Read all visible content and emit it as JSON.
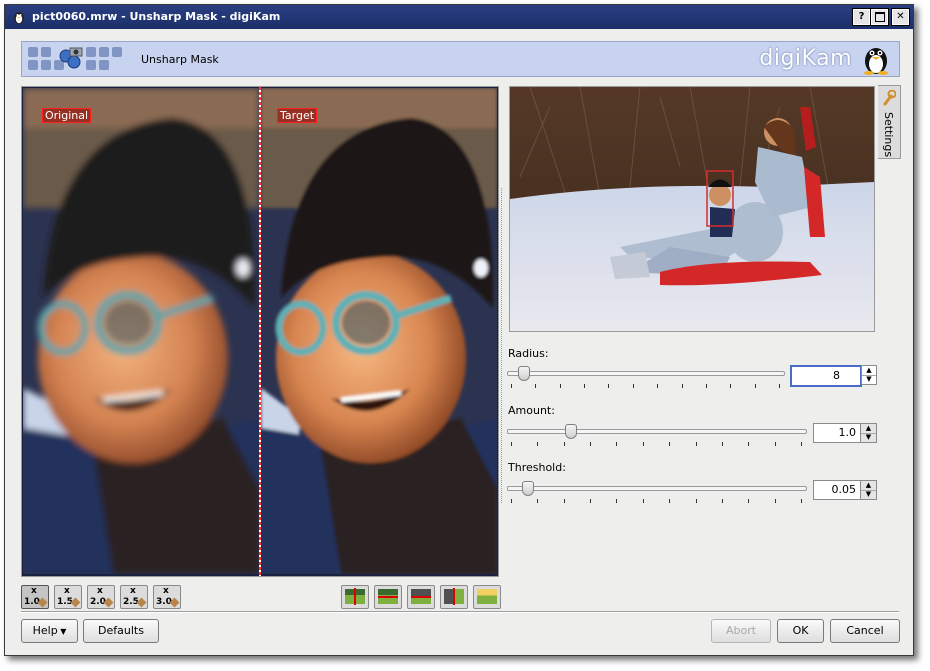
{
  "window": {
    "title": "pict0060.mrw - Unsharp Mask - digiKam"
  },
  "titlebar_buttons": {
    "help": "?",
    "close": "✕"
  },
  "header": {
    "title": "Unsharp Mask",
    "brand": "digiKam"
  },
  "preview": {
    "original_label": "Original",
    "target_label": "Target"
  },
  "zoom_buttons": [
    {
      "label": "1.0",
      "mark": "x"
    },
    {
      "label": "1.5",
      "mark": "x"
    },
    {
      "label": "2.0",
      "mark": "x"
    },
    {
      "label": "2.5",
      "mark": "x"
    },
    {
      "label": "3.0",
      "mark": "x"
    }
  ],
  "settings_tab": {
    "label": "Settings"
  },
  "controls": {
    "radius": {
      "label": "Radius:",
      "value": "8",
      "level": 0.04
    },
    "amount": {
      "label": "Amount:",
      "value": "1.0",
      "level": 0.2
    },
    "threshold": {
      "label": "Threshold:",
      "value": "0.05",
      "level": 0.05
    }
  },
  "buttons": {
    "help": "Help",
    "defaults": "Defaults",
    "abort": "Abort",
    "ok": "OK",
    "cancel": "Cancel"
  },
  "colors": {
    "accent": "#4a6cc8",
    "titlebar": "#1c2f6a",
    "header": "#c8d3f0"
  }
}
